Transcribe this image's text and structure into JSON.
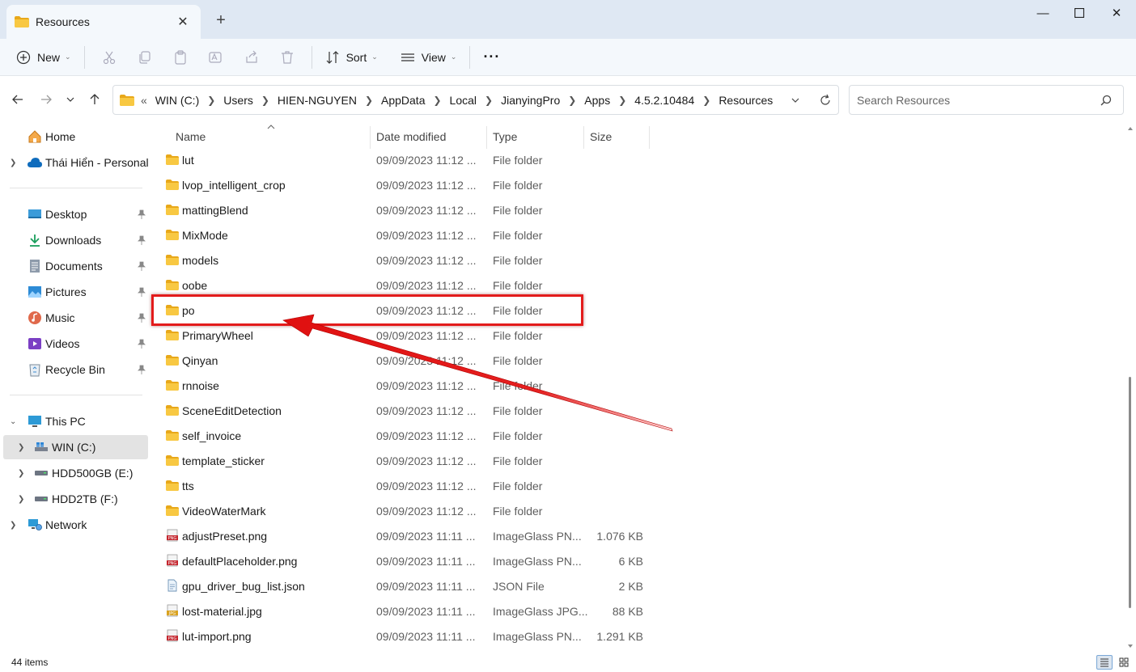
{
  "tab": {
    "title": "Resources"
  },
  "toolbar": {
    "new_label": "New",
    "sort_label": "Sort",
    "view_label": "View",
    "more_label": "···"
  },
  "address": {
    "overflow": "«",
    "crumbs": [
      "WIN (C:)",
      "Users",
      "HIEN-NGUYEN",
      "AppData",
      "Local",
      "JianyingPro",
      "Apps",
      "4.5.2.10484",
      "Resources"
    ]
  },
  "search": {
    "placeholder": "Search Resources"
  },
  "sidebar": {
    "home": "Home",
    "onedrive": "Thái Hiển - Personal",
    "quick": [
      "Desktop",
      "Downloads",
      "Documents",
      "Pictures",
      "Music",
      "Videos",
      "Recycle Bin"
    ],
    "this_pc": "This PC",
    "drives": [
      "WIN (C:)",
      "HDD500GB (E:)",
      "HDD2TB (F:)"
    ],
    "network": "Network"
  },
  "columns": {
    "name": "Name",
    "date": "Date modified",
    "type": "Type",
    "size": "Size"
  },
  "files": [
    {
      "name": "lut",
      "date": "09/09/2023 11:12 ...",
      "type": "File folder",
      "size": "",
      "icon": "folder-icon"
    },
    {
      "name": "lvop_intelligent_crop",
      "date": "09/09/2023 11:12 ...",
      "type": "File folder",
      "size": "",
      "icon": "folder-icon"
    },
    {
      "name": "mattingBlend",
      "date": "09/09/2023 11:12 ...",
      "type": "File folder",
      "size": "",
      "icon": "folder-icon"
    },
    {
      "name": "MixMode",
      "date": "09/09/2023 11:12 ...",
      "type": "File folder",
      "size": "",
      "icon": "folder-icon"
    },
    {
      "name": "models",
      "date": "09/09/2023 11:12 ...",
      "type": "File folder",
      "size": "",
      "icon": "folder-icon"
    },
    {
      "name": "oobe",
      "date": "09/09/2023 11:12 ...",
      "type": "File folder",
      "size": "",
      "icon": "folder-icon"
    },
    {
      "name": "po",
      "date": "09/09/2023 11:12 ...",
      "type": "File folder",
      "size": "",
      "icon": "folder-icon"
    },
    {
      "name": "PrimaryWheel",
      "date": "09/09/2023 11:12 ...",
      "type": "File folder",
      "size": "",
      "icon": "folder-icon"
    },
    {
      "name": "Qinyan",
      "date": "09/09/2023 11:12 ...",
      "type": "File folder",
      "size": "",
      "icon": "folder-icon"
    },
    {
      "name": "rnnoise",
      "date": "09/09/2023 11:12 ...",
      "type": "File folder",
      "size": "",
      "icon": "folder-icon"
    },
    {
      "name": "SceneEditDetection",
      "date": "09/09/2023 11:12 ...",
      "type": "File folder",
      "size": "",
      "icon": "folder-icon"
    },
    {
      "name": "self_invoice",
      "date": "09/09/2023 11:12 ...",
      "type": "File folder",
      "size": "",
      "icon": "folder-icon"
    },
    {
      "name": "template_sticker",
      "date": "09/09/2023 11:12 ...",
      "type": "File folder",
      "size": "",
      "icon": "folder-icon"
    },
    {
      "name": "tts",
      "date": "09/09/2023 11:12 ...",
      "type": "File folder",
      "size": "",
      "icon": "folder-icon"
    },
    {
      "name": "VideoWaterMark",
      "date": "09/09/2023 11:12 ...",
      "type": "File folder",
      "size": "",
      "icon": "folder-icon"
    },
    {
      "name": "adjustPreset.png",
      "date": "09/09/2023 11:11 ...",
      "type": "ImageGlass PN...",
      "size": "1.076 KB",
      "icon": "png-file-icon"
    },
    {
      "name": "defaultPlaceholder.png",
      "date": "09/09/2023 11:11 ...",
      "type": "ImageGlass PN...",
      "size": "6 KB",
      "icon": "png-file-icon"
    },
    {
      "name": "gpu_driver_bug_list.json",
      "date": "09/09/2023 11:11 ...",
      "type": "JSON File",
      "size": "2 KB",
      "icon": "json-file-icon"
    },
    {
      "name": "lost-material.jpg",
      "date": "09/09/2023 11:11 ...",
      "type": "ImageGlass JPG...",
      "size": "88 KB",
      "icon": "jpg-file-icon"
    },
    {
      "name": "lut-import.png",
      "date": "09/09/2023 11:11 ...",
      "type": "ImageGlass PN...",
      "size": "1.291 KB",
      "icon": "png-file-icon"
    }
  ],
  "highlighted_item": "po",
  "status": {
    "count": "44 items"
  },
  "colors": {
    "accent": "#0067c0",
    "highlight": "#e31b1b",
    "folder": "#f8c842",
    "titlebar": "#dfe8f3"
  }
}
